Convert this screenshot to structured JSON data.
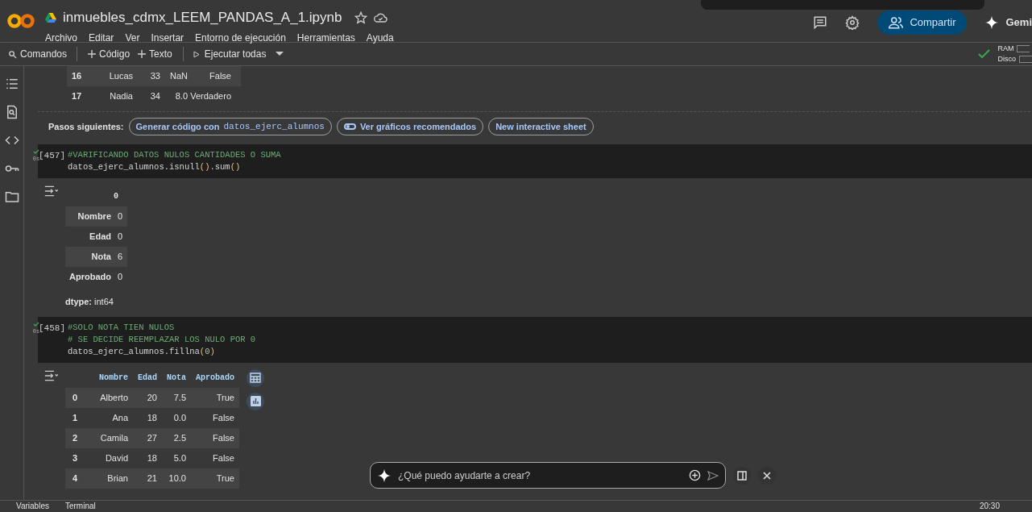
{
  "header": {
    "title": "inmuebles_cdmx_LEEM_PANDAS_A_1.ipynb",
    "menu": [
      "Archivo",
      "Editar",
      "Ver",
      "Insertar",
      "Entorno de ejecución",
      "Herramientas",
      "Ayuda"
    ],
    "share": "Compartir",
    "gemini": "Gemi"
  },
  "toolbar": {
    "items": [
      {
        "kind": "search",
        "label": "Comandos"
      },
      {
        "kind": "divider"
      },
      {
        "kind": "add",
        "label": "Código"
      },
      {
        "kind": "add",
        "label": "Texto"
      },
      {
        "kind": "divider"
      },
      {
        "kind": "run",
        "label": "Ejecutar todas"
      },
      {
        "kind": "caret"
      }
    ],
    "connected": true,
    "resources": [
      "RAM",
      "Disco"
    ]
  },
  "previous_table": {
    "rows": [
      [
        "16",
        "Lucas",
        "33",
        "NaN",
        "False"
      ],
      [
        "17",
        "Nadia",
        "34",
        "8.0",
        "Verdadero"
      ]
    ]
  },
  "next_steps": {
    "label": "Pasos siguientes:",
    "chips": [
      {
        "kind": "code",
        "label": "Generar código con",
        "code": "datos_ejerc_alumnos"
      },
      {
        "kind": "toggle",
        "label": "Ver gráficos recomendados"
      },
      {
        "kind": "plain",
        "label": "New interactive sheet"
      }
    ]
  },
  "cells": [
    {
      "count": "[457]",
      "time": "0s",
      "lines": [
        [
          {
            "kind": "comment",
            "text": "#VARIFICANDO DATOS NULOS CANTIDADES O SUMA"
          }
        ],
        [
          {
            "kind": "code",
            "text": "datos_ejerc_alumnos.isnull"
          },
          {
            "kind": "paren",
            "text": "()"
          },
          {
            "kind": "code",
            "text": ".sum"
          },
          {
            "kind": "paren",
            "text": "()"
          }
        ]
      ],
      "output": {
        "kind": "series",
        "header": "0",
        "rows": [
          [
            "Nombre",
            "0"
          ],
          [
            "Edad",
            "0"
          ],
          [
            "Nota",
            "6"
          ],
          [
            "Aprobado",
            "0"
          ]
        ],
        "dtype": "**dtype:** int64"
      }
    },
    {
      "count": "[458]",
      "time": "0s",
      "lines": [
        [
          {
            "kind": "comment",
            "text": "#SOLO NOTA TIEN NULOS"
          }
        ],
        [
          {
            "kind": "comment",
            "text": "# SE DECIDE REEMPLAZAR LOS NULO POR 0"
          }
        ],
        [
          {
            "kind": "code",
            "text": "datos_ejerc_alumnos.fillna"
          },
          {
            "kind": "paren",
            "text": "("
          },
          {
            "kind": "number",
            "text": "0"
          },
          {
            "kind": "paren",
            "text": ")"
          }
        ]
      ],
      "output": {
        "kind": "dataframe",
        "columns": [
          "",
          "Nombre",
          "Edad",
          "Nota",
          "Aprobado"
        ],
        "rows": [
          [
            "0",
            "Alberto",
            "20",
            "7.5",
            "True"
          ],
          [
            "1",
            "Ana",
            "18",
            "0.0",
            "False"
          ],
          [
            "2",
            "Camila",
            "27",
            "2.5",
            "False"
          ],
          [
            "3",
            "David",
            "18",
            "5.0",
            "False"
          ],
          [
            "4",
            "Brian",
            "21",
            "10.0",
            "True"
          ]
        ]
      }
    }
  ],
  "chat": {
    "placeholder": "¿Qué puedo ayudarte a crear?"
  },
  "status_bar": {
    "items": [
      "Variables",
      "Terminal"
    ],
    "time": "20:30"
  }
}
